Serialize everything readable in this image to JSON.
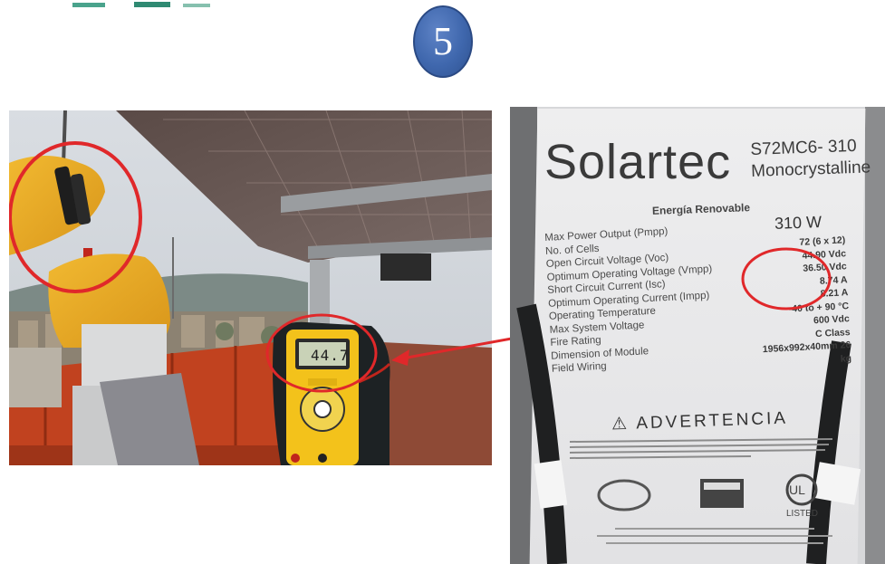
{
  "step_number": "5",
  "multimeter": {
    "reading": "44.7"
  },
  "panel_label": {
    "brand": "Solartec",
    "model": "S72MC6- 310",
    "type": "Monocrystalline",
    "subtitle": "Energía Renovable",
    "power": "310 W",
    "specs": [
      {
        "label": "Max Power Output (Pmpp)",
        "value": ""
      },
      {
        "label": "No. of Cells",
        "value": "72 (6 x 12)"
      },
      {
        "label": "Open Circuit Voltage (Voc)",
        "value": "44.90 Vdc"
      },
      {
        "label": "Optimum Operating Voltage (Vmpp)",
        "value": "36.50 Vdc"
      },
      {
        "label": "Short Circuit Current (Isc)",
        "value": "8.74 A"
      },
      {
        "label": "Optimum Operating Current (Impp)",
        "value": "8.21 A"
      },
      {
        "label": "Operating Temperature",
        "value": "-40 to + 90 °C"
      },
      {
        "label": "Max System Voltage",
        "value": "600 Vdc"
      },
      {
        "label": "Fire Rating",
        "value": "C Class"
      },
      {
        "label": "Dimension of Module",
        "value": "1956x992x40mm  26 kg"
      },
      {
        "label": "Field Wiring",
        "value": ""
      }
    ],
    "warning": "ADVERTENCIA",
    "cert_badge": "LISTED"
  },
  "colors": {
    "annotation_red": "#e0282a",
    "badge_blue": "#4169b0"
  }
}
